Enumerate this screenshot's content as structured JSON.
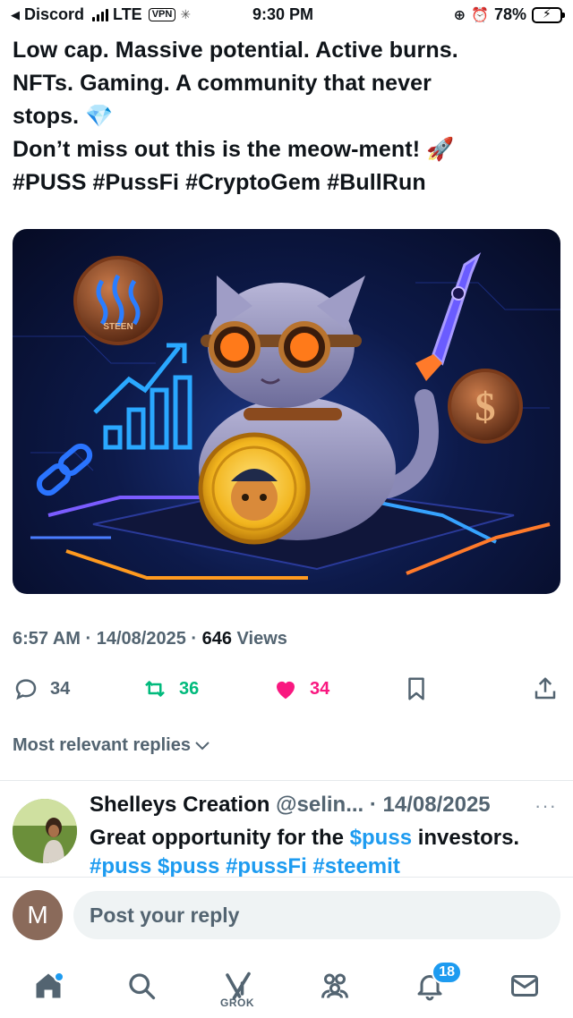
{
  "status_bar": {
    "back_app": "Discord",
    "network": "LTE",
    "vpn": "VPN",
    "time": "9:30 PM",
    "battery": "78%",
    "battery_level": 0.78
  },
  "tweet": {
    "lines": [
      "Low cap. Massive potential. Active burns.",
      "NFTs. Gaming. A community that never",
      "stops. 💎",
      "Don’t miss out  this is the meow-ment! 🚀",
      "#PUSS #PussFi #CryptoGem #BullRun"
    ],
    "image": {
      "coin_left_text": "STEEN",
      "coin_right_symbol": "$"
    },
    "meta": {
      "time": "6:57 AM",
      "sep": " · ",
      "date": "14/08/2025",
      "views_count": "646",
      "views_label": " Views"
    },
    "actions": {
      "replies": "34",
      "retweets": "36",
      "likes": "34"
    }
  },
  "replies_filter": "Most relevant replies",
  "reply": {
    "name": "Shelleys Creation",
    "handle": "@selin...",
    "sep": " · ",
    "date": "14/08/2025",
    "more": "···",
    "text_prefix": "Great opportunity for the ",
    "cashtag": "$puss",
    "text_suffix": " investors.",
    "tags": "#puss $puss #pussFi #steemit"
  },
  "compose": {
    "avatar_letter": "M",
    "placeholder": "Post your reply"
  },
  "tabbar": {
    "grok_label": "GROK",
    "notifications_count": "18"
  },
  "colors": {
    "accent": "#1d9bf0",
    "retweet": "#00ba7c",
    "like": "#f91880",
    "muted": "#536471"
  }
}
